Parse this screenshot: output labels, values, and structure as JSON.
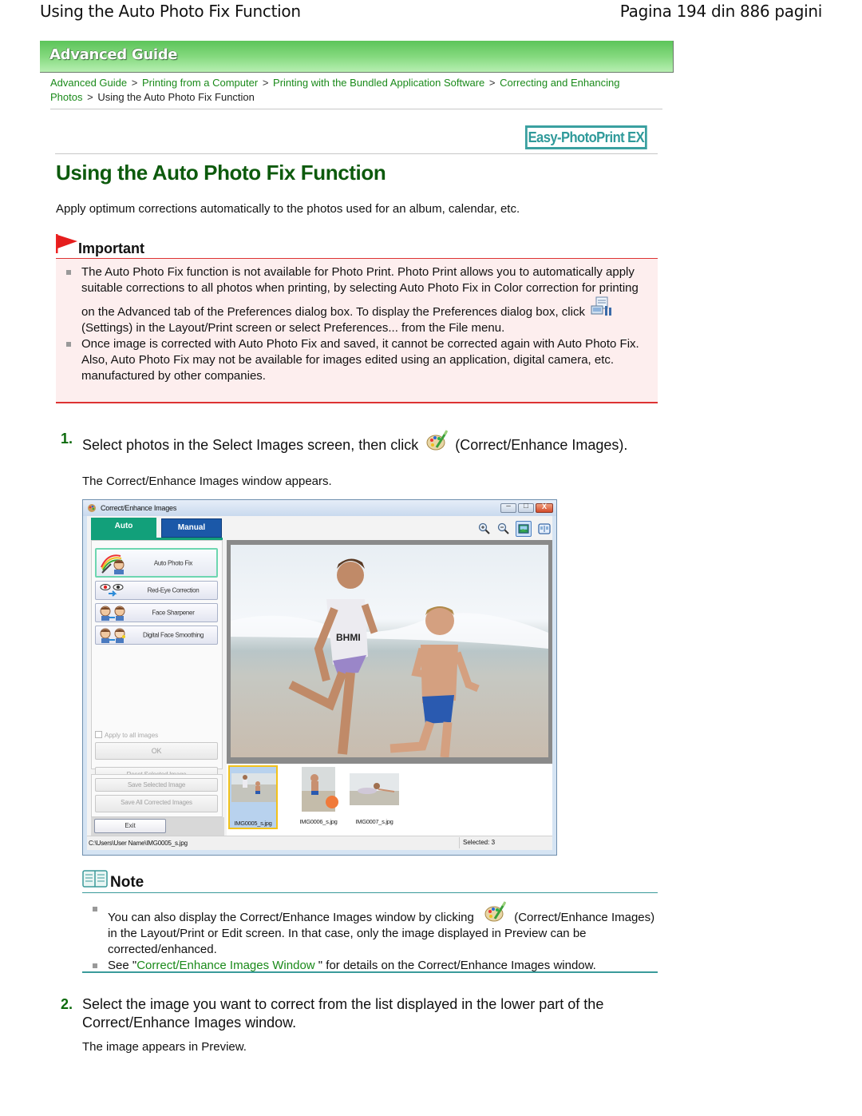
{
  "page_header": {
    "title": "Using the Auto Photo Fix Function",
    "page_indicator": "Pagina 194 din 886 pagini"
  },
  "banner": {
    "label": "Advanced Guide"
  },
  "breadcrumb": {
    "items": [
      {
        "label": "Advanced Guide",
        "link": true
      },
      {
        "label": "Printing from a Computer",
        "link": true
      },
      {
        "label": "Printing with the Bundled Application Software",
        "link": true
      },
      {
        "label": "Correcting and Enhancing Photos",
        "link": true
      },
      {
        "label": "Using the Auto Photo Fix Function",
        "link": false
      }
    ],
    "separator": ">"
  },
  "app_badge": "Easy-PhotoPrint EX",
  "heading": "Using the Auto Photo Fix Function",
  "intro": "Apply optimum corrections automatically to the photos used for an album, calendar, etc.",
  "important": {
    "label": "Important",
    "items": [
      {
        "before_icon": "The Auto Photo Fix function is not available for Photo Print. Photo Print allows you to automatically apply suitable corrections to all photos when printing, by selecting Auto Photo Fix in Color correction for printing on the Advanced tab of the Preferences dialog box. To display the Preferences dialog box, click",
        "icon": "settings-icon",
        "after_icon": "(Settings) in the Layout/Print screen or select Preferences... from the File menu."
      },
      {
        "text": "Once image is corrected with Auto Photo Fix and saved, it cannot be corrected again with Auto Photo Fix.",
        "extra": "Also, Auto Photo Fix may not be available for images edited using an application, digital camera, etc. manufactured by other companies."
      }
    ]
  },
  "steps": [
    {
      "number": "1.",
      "before_icon": "Select photos in the Select Images screen, then click",
      "icon": "correct-enhance-icon",
      "after_icon": "(Correct/Enhance Images).",
      "result": "The Correct/Enhance Images window appears."
    },
    {
      "number": "2.",
      "text": "Select the image you want to correct from the list displayed in the lower part of the Correct/Enhance Images window.",
      "result": "The image appears in Preview."
    }
  ],
  "window": {
    "title": "Correct/Enhance Images",
    "tabs": [
      {
        "label": "Auto",
        "active": true
      },
      {
        "label": "Manual",
        "active": false
      }
    ],
    "correction_buttons": [
      {
        "label": "Auto Photo Fix",
        "icon": "auto-photo-fix-icon",
        "active": true
      },
      {
        "label": "Red-Eye Correction",
        "icon": "red-eye-icon",
        "active": false
      },
      {
        "label": "Face Sharpener",
        "icon": "face-sharpener-icon",
        "active": false
      },
      {
        "label": "Digital Face Smoothing",
        "icon": "face-smoothing-icon",
        "active": false
      }
    ],
    "apply_all_label": "Apply to all images",
    "apply_all_checked": false,
    "ok_label": "OK",
    "reset_label": "Reset Selected Image",
    "save_selected_label": "Save Selected Image",
    "save_all_label": "Save All Corrected Images",
    "exit_label": "Exit",
    "toolbar": [
      "zoom-in-icon",
      "zoom-out-icon",
      "whole-image-icon",
      "compare-icon"
    ],
    "thumbnails": [
      {
        "name": "IMG0005_s.jpg",
        "selected": true
      },
      {
        "name": "IMG0006_s.jpg",
        "selected": false
      },
      {
        "name": "IMG0007_s.jpg",
        "selected": false
      }
    ],
    "status_path": "C:\\Users\\User Name\\IMG0005_s.jpg",
    "status_selected": "Selected: 3",
    "controls": {
      "minimize": "–",
      "maximize": "□",
      "close": "X"
    }
  },
  "note": {
    "label": "Note",
    "items": [
      {
        "before_icon": "You can also display the Correct/Enhance Images window by clicking",
        "icon": "correct-enhance-icon",
        "after_icon": "(Correct/Enhance Images) in the Layout/Print or Edit screen. In that case, only the image displayed in Preview can be corrected/enhanced."
      },
      {
        "before_link": "See \"",
        "link": "Correct/Enhance Images Window",
        "after_link": " \" for details on the Correct/Enhance Images window."
      }
    ]
  },
  "colors": {
    "heading_green": "#0d5a0d",
    "link_green": "#1a8a1a",
    "important_red": "#dd3333",
    "important_bg": "#fdeeee",
    "note_teal": "#3a9a9a",
    "badge_teal": "#3aa0a0"
  }
}
